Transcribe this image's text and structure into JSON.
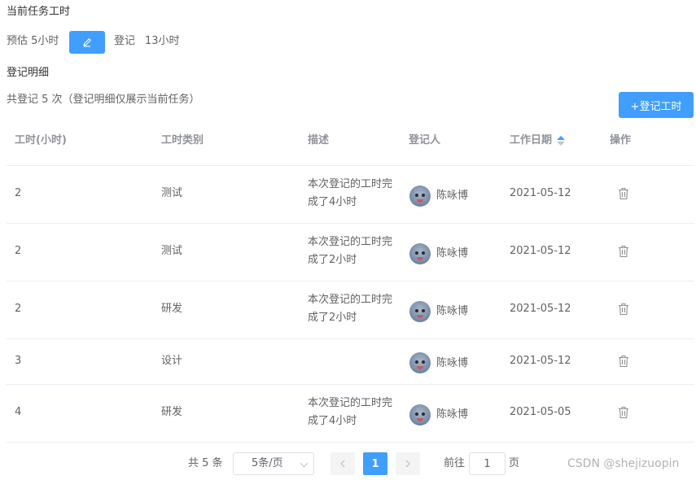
{
  "header": {
    "title": "当前任务工时",
    "estimate_label": "预估 5小时",
    "registered_label": "登记",
    "registered_value": "13小时"
  },
  "details": {
    "title": "登记明细",
    "summary": "共登记 5 次（登记明细仅展示当前任务）",
    "add_button": "+登记工时"
  },
  "table": {
    "columns": [
      "工时(小时)",
      "工时类别",
      "描述",
      "登记人",
      "工作日期",
      "操作"
    ],
    "rows": [
      {
        "hours": "2",
        "category": "测试",
        "desc": "本次登记的工时完成了4小时",
        "user": "陈咏博",
        "date": "2021-05-12"
      },
      {
        "hours": "2",
        "category": "测试",
        "desc": "本次登记的工时完成了2小时",
        "user": "陈咏博",
        "date": "2021-05-12"
      },
      {
        "hours": "2",
        "category": "研发",
        "desc": "本次登记的工时完成了2小时",
        "user": "陈咏博",
        "date": "2021-05-12"
      },
      {
        "hours": "3",
        "category": "设计",
        "desc": "",
        "user": "陈咏博",
        "date": "2021-05-12"
      },
      {
        "hours": "4",
        "category": "研发",
        "desc": "本次登记的工时完成了4小时",
        "user": "陈咏博",
        "date": "2021-05-05"
      }
    ]
  },
  "pagination": {
    "total": "共 5 条",
    "page_size": "5条/页",
    "current": "1",
    "goto_label": "前往",
    "goto_value": "1",
    "page_label": "页"
  },
  "watermark": "CSDN @shejizuopin",
  "colors": {
    "primary": "#409eff",
    "text": "#606266",
    "header": "#909399",
    "border": "#ebeef5"
  }
}
